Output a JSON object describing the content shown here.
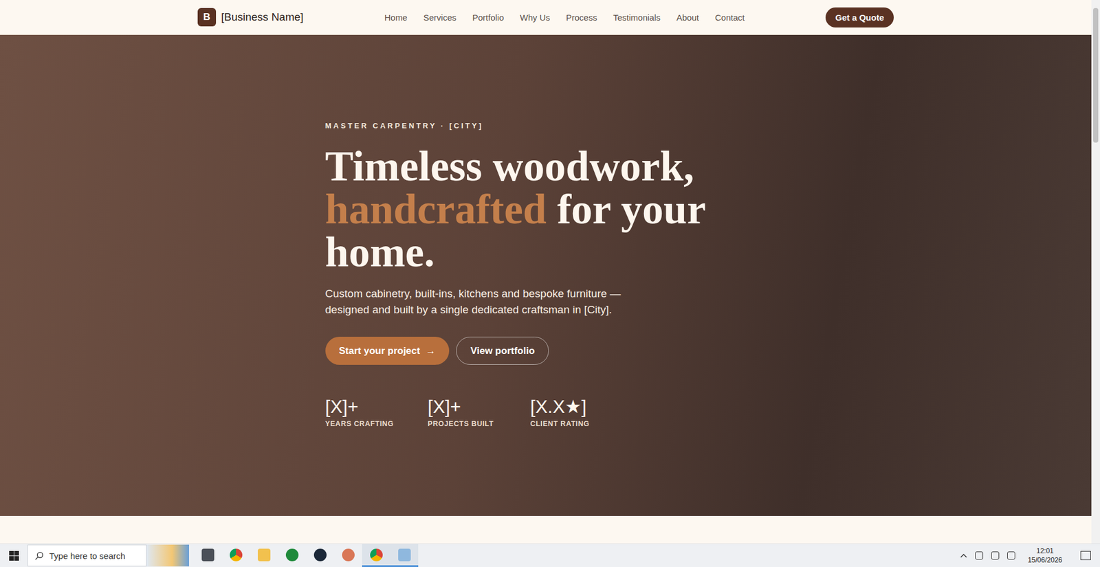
{
  "nav": {
    "logo_letter": "B",
    "brand": "[Business Name]",
    "links": [
      {
        "label": "Home",
        "selected": false
      },
      {
        "label": "Services",
        "selected": false
      },
      {
        "label": "Portfolio",
        "selected": false
      },
      {
        "label": "Why Us",
        "selected": false
      },
      {
        "label": "Process",
        "selected": false
      },
      {
        "label": "Testimonials",
        "selected": false
      },
      {
        "label": "About",
        "selected": false
      },
      {
        "label": "Contact",
        "selected": false
      }
    ],
    "cta": "Get a Quote"
  },
  "hero": {
    "eyebrow": "MASTER CARPENTRY · [CITY]",
    "heading_lines": [
      [
        {
          "text": "Timeless woodwork,",
          "accent": false
        }
      ],
      [
        {
          "text": "handcrafted",
          "accent": true
        },
        {
          "text": " for your",
          "accent": false
        }
      ],
      [
        {
          "text": "home.",
          "accent": false
        }
      ]
    ],
    "subtitle_lines": [
      "Custom cabinetry, built-ins, kitchens and bespoke furniture —",
      "designed and built by a single dedicated craftsman in [City]."
    ],
    "primary_button": {
      "label": "Start your project",
      "arrow": "→"
    },
    "secondary_button": {
      "label": "View portfolio"
    },
    "stats": [
      {
        "value": "[X]+",
        "label": "YEARS CRAFTING"
      },
      {
        "value": "[X]+",
        "label": "PROJECTS BUILT"
      },
      {
        "value": "[X.X★]",
        "label": "CLIENT RATING"
      }
    ]
  },
  "taskbar": {
    "search_placeholder": "Type here to search",
    "time": "12:01",
    "date": "15/06/2026"
  }
}
